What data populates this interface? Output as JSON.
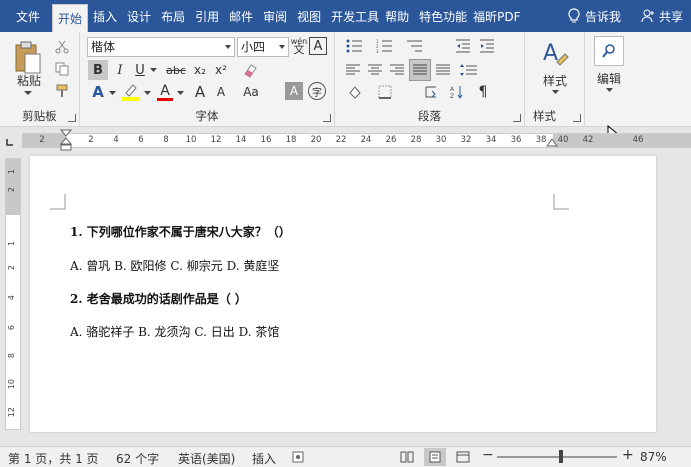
{
  "tabs": [
    "文件",
    "开始",
    "插入",
    "设计",
    "布局",
    "引用",
    "邮件",
    "审阅",
    "视图",
    "开发工具",
    "帮助",
    "特色功能",
    "福昕PDF"
  ],
  "tab_active_index": 1,
  "tell_me": "告诉我",
  "share": "共享",
  "ribbon": {
    "clipboard": {
      "paste_label": "粘贴",
      "group_label": "剪贴板"
    },
    "font": {
      "font_name": "楷体",
      "font_size": "小四",
      "group_label": "字体",
      "bold": "B",
      "italic": "I",
      "underline": "U",
      "strike": "abc",
      "sub": "x₂",
      "sup": "x²",
      "phonetic": "wén",
      "border_char": "A",
      "grow": "A",
      "shrink": "A",
      "clear": "Aa",
      "shade": "A",
      "enclose": "字"
    },
    "paragraph": {
      "group_label": "段落"
    },
    "styles": {
      "label": "样式",
      "group_label": "样式"
    },
    "editing": {
      "label": "编辑"
    }
  },
  "ruler": {
    "h": [
      "2",
      "2",
      "4",
      "6",
      "8",
      "10",
      "12",
      "14",
      "16",
      "18",
      "20",
      "22",
      "24",
      "26",
      "28",
      "30",
      "32",
      "34",
      "36",
      "38",
      "40",
      "42",
      "46"
    ],
    "v": [
      "1",
      "2",
      "1",
      "2",
      "4",
      "6",
      "8",
      "10",
      "12"
    ]
  },
  "document": {
    "q1": "1. 下列哪位作家不属于唐宋八大家？（）",
    "a1": "A. 曾巩 B. 欧阳修 C. 柳宗元 D. 黄庭坚",
    "q2": "2. 老舍最成功的话剧作品是（    ）",
    "a2": "A. 骆驼祥子 B. 龙须沟 C. 日出 D. 茶馆"
  },
  "status": {
    "page": "第 1 页，共 1 页",
    "words": "62 个字",
    "lang": "英语(美国)",
    "mode": "插入",
    "zoom": "87%"
  },
  "colors": {
    "accent": "#2b579a",
    "highlight": "#ffff00",
    "fontcolor": "#e00000"
  }
}
